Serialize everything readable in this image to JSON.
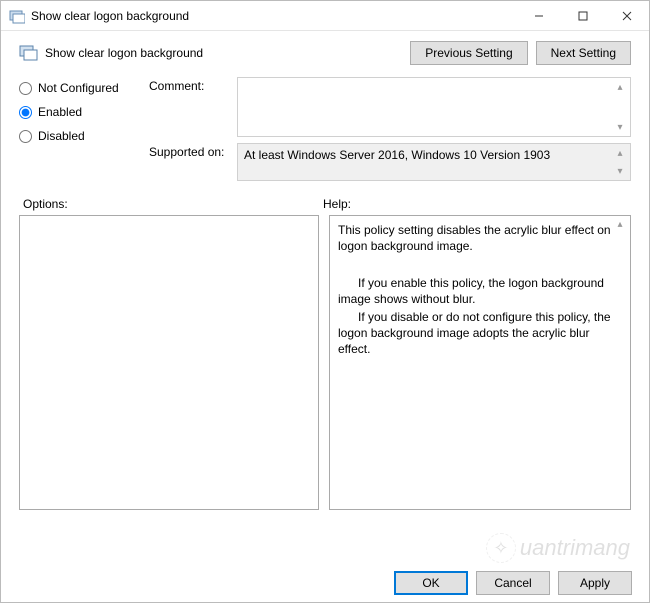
{
  "titlebar": {
    "title": "Show clear logon background"
  },
  "header": {
    "title": "Show clear logon background",
    "previous_btn": "Previous Setting",
    "next_btn": "Next Setting"
  },
  "config": {
    "radio": {
      "not_configured": "Not Configured",
      "enabled": "Enabled",
      "disabled": "Disabled",
      "selected": "enabled"
    },
    "comment_label": "Comment:",
    "comment_value": "",
    "supported_label": "Supported on:",
    "supported_value": "At least Windows Server 2016, Windows 10 Version 1903"
  },
  "options": {
    "label": "Options:"
  },
  "help": {
    "label": "Help:",
    "p1": "This policy setting disables the acrylic blur effect on logon background image.",
    "p2": "If you enable this policy, the logon background image shows without blur.",
    "p3": "If you disable or do not configure this policy, the logon background image adopts the acrylic blur effect."
  },
  "footer": {
    "ok": "OK",
    "cancel": "Cancel",
    "apply": "Apply"
  },
  "watermark": "uantrimang"
}
